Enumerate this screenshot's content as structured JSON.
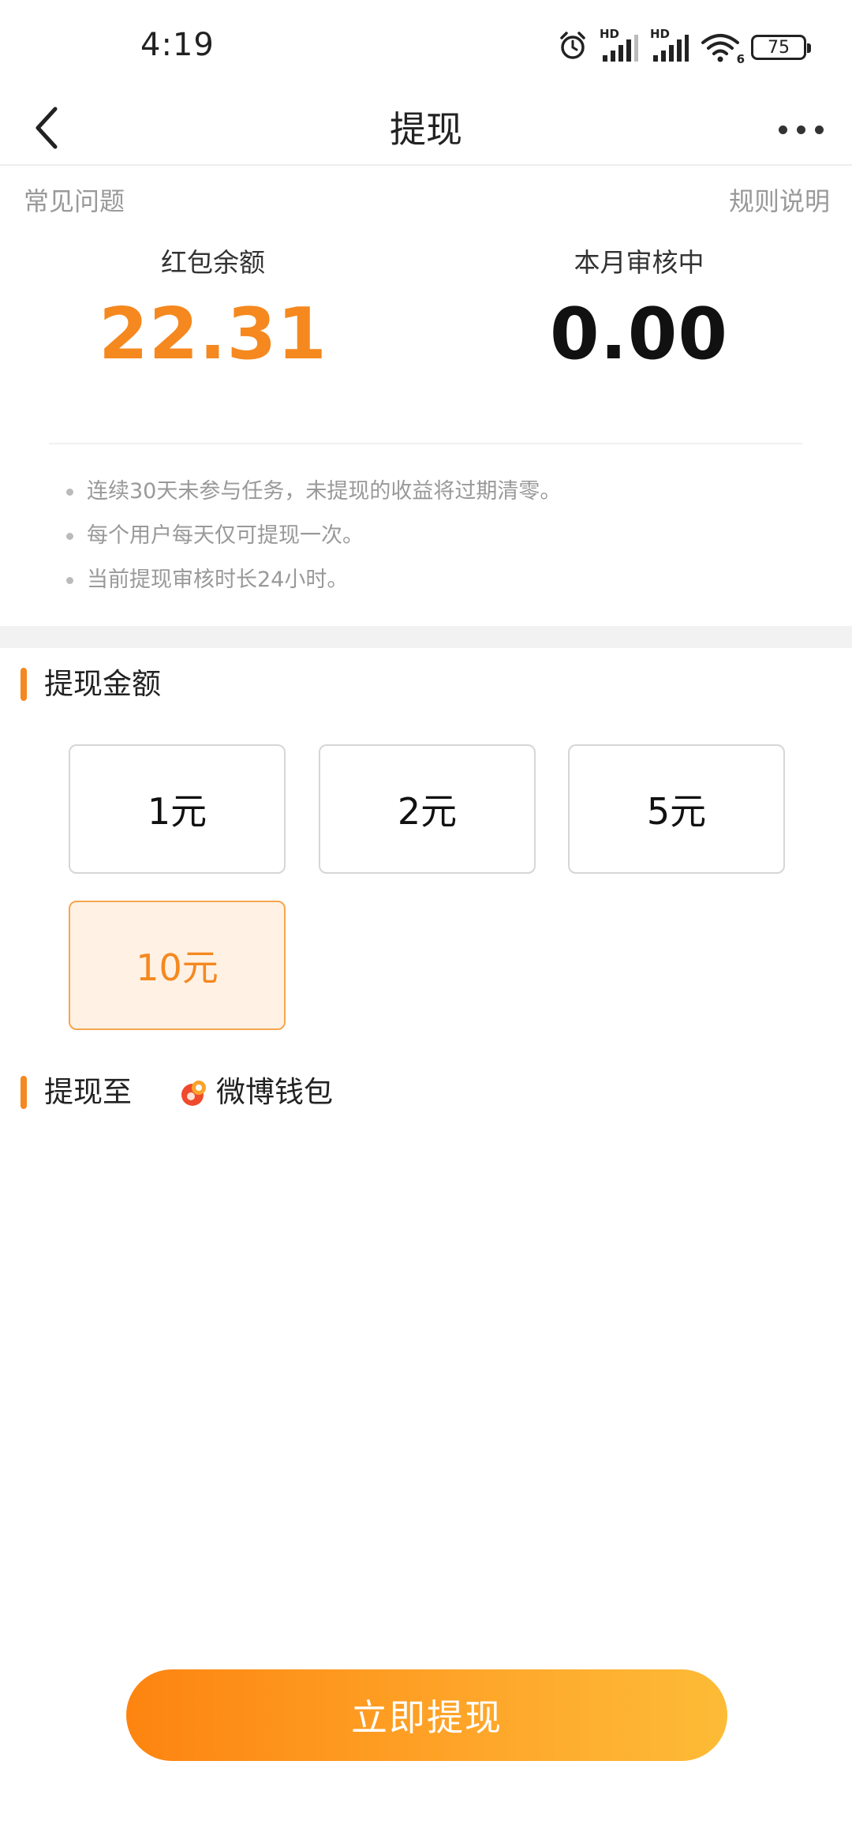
{
  "status_bar": {
    "time": "4:19",
    "network_label_1": "HD",
    "network_label_2": "HD",
    "wifi_sub": "6",
    "battery": "75"
  },
  "nav": {
    "title": "提现",
    "back_icon": "chevron-left-icon",
    "more_icon": "more-dots-icon"
  },
  "links": {
    "faq": "常见问题",
    "rules": "规则说明"
  },
  "balances": {
    "red_packet_label": "红包余额",
    "red_packet_value": "22.31",
    "pending_label": "本月审核中",
    "pending_value": "0.00"
  },
  "notes": [
    "连续30天未参与任务，未提现的收益将过期清零。",
    "每个用户每天仅可提现一次。",
    "当前提现审核时长24小时。"
  ],
  "amount_section": {
    "title": "提现金额",
    "options": [
      "1元",
      "2元",
      "5元",
      "10元"
    ],
    "selected": "10元"
  },
  "destination_section": {
    "title": "提现至",
    "wallet_name": "微博钱包",
    "wallet_icon": "weibo-wallet-icon"
  },
  "submit_button": "立即提现",
  "colors": {
    "accent": "#f5881f",
    "selected_bg": "#fff1e4",
    "button_gradient_start": "#fd8410",
    "button_gradient_end": "#fdbb36",
    "muted_text": "#999999"
  }
}
